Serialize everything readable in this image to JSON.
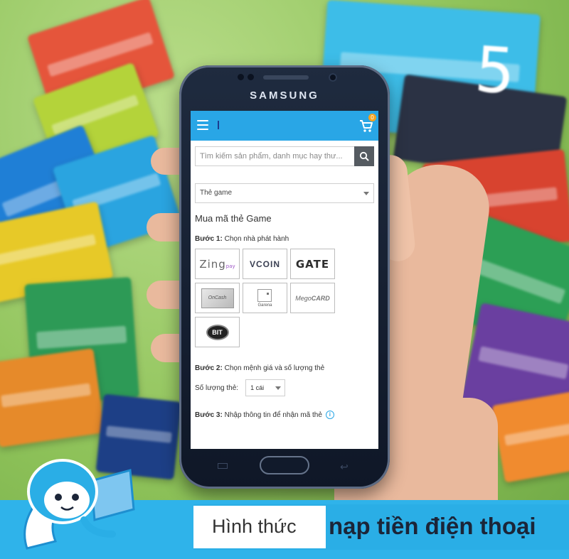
{
  "device": {
    "brand": "SAMSUNG"
  },
  "app": {
    "cart_badge": "0",
    "search": {
      "placeholder": "Tìm kiếm sản phẩm, danh mục hay thư..."
    },
    "category_select": {
      "selected": "Thẻ game"
    },
    "section_title": "Mua mã thẻ Game",
    "step1": {
      "label": "Bước 1:",
      "text": "Chọn nhà phát hành"
    },
    "publishers": [
      {
        "name": "Zing",
        "suffix": "pay"
      },
      {
        "name": "VCOIN"
      },
      {
        "name": "GATE"
      },
      {
        "name": "OnCash"
      },
      {
        "name": "Garena"
      },
      {
        "name": "Mego",
        "suffix": "CARD"
      },
      {
        "name": "BIT"
      }
    ],
    "step2": {
      "label": "Bước 2:",
      "text": "Chọn mệnh giá và số lượng thẻ"
    },
    "quantity": {
      "label": "Số lượng thẻ:",
      "selected": "1 cái"
    },
    "step3": {
      "label": "Bước 3:",
      "text": "Nhập thông tin để nhận mã thẻ"
    }
  },
  "background": {
    "card_text": "5"
  },
  "banner": {
    "normal_text": "Hình thức",
    "bold_text": "nạp tiền điện thoại"
  },
  "colors": {
    "accent": "#29a6e6",
    "banner": "#2fb3ea",
    "background_green": "#9ccf6a"
  }
}
